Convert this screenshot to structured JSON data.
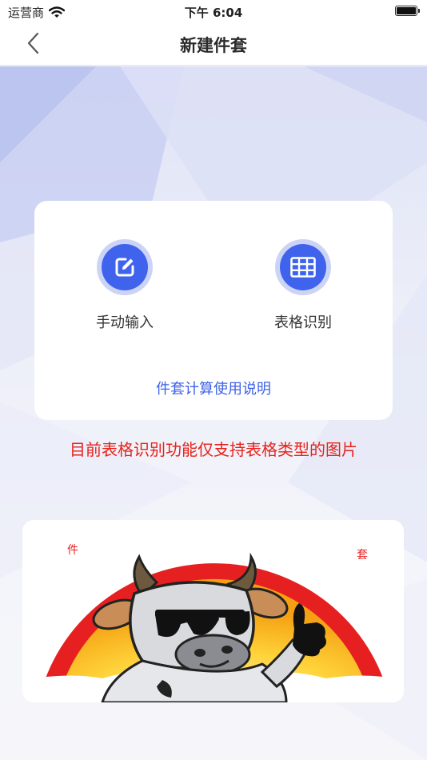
{
  "status_bar": {
    "carrier": "运营商",
    "time": "下午 6:04"
  },
  "nav": {
    "title": "新建件套"
  },
  "card": {
    "manual_label": "手动输入",
    "table_label": "表格识别",
    "help_link": "件套计算使用说明"
  },
  "notice": "目前表格识别功能仅支持表格类型的图片",
  "banner": {
    "char_left": "件",
    "char_right": "套"
  },
  "colors": {
    "accent": "#3f63ec",
    "notice": "#e5231b",
    "link": "#3d62e6"
  }
}
